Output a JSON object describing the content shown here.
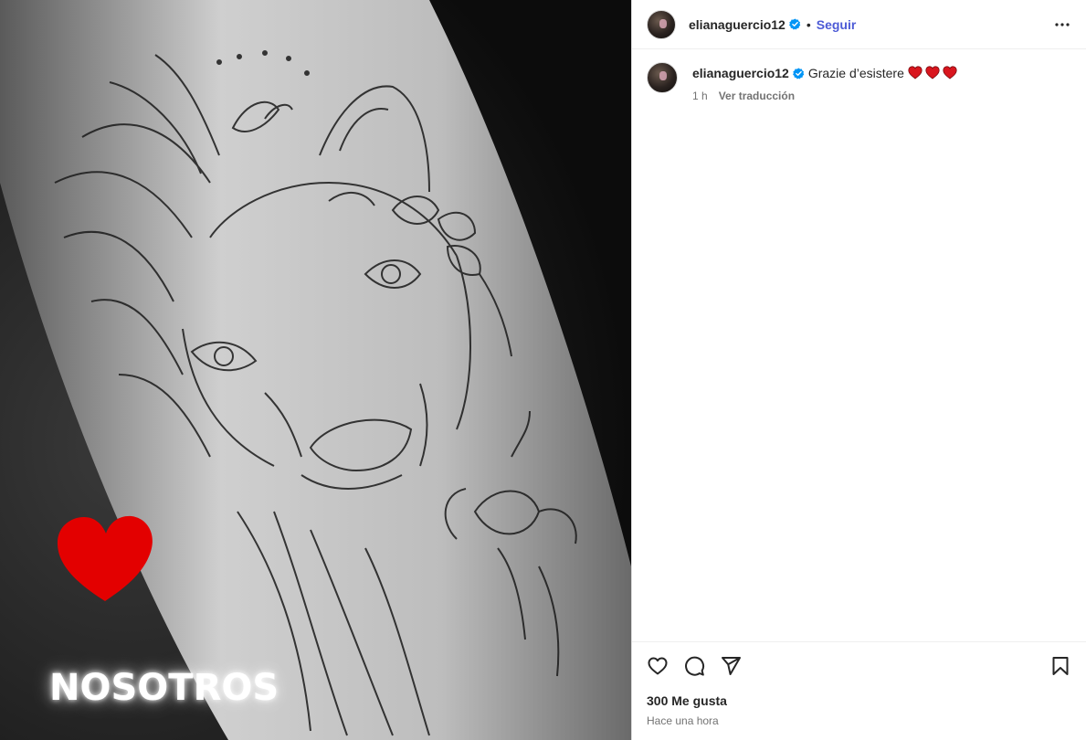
{
  "media": {
    "overlay_text": "NOSOTROS",
    "overlay_heart_color": "#e30000"
  },
  "post": {
    "username": "elianaguercio12",
    "follow_label": "Seguir",
    "separator": "•",
    "caption": {
      "username": "elianaguercio12",
      "text": "Grazie d’esistere",
      "emoji_count": 3
    },
    "time_short": "1 h",
    "translate_label": "Ver traducción",
    "likes": "300 Me gusta",
    "time_long": "Hace una hora"
  },
  "colors": {
    "follow_link": "#4d5bd6",
    "verified_badge": "#0095f6",
    "heart_emoji": "#d9161e"
  }
}
